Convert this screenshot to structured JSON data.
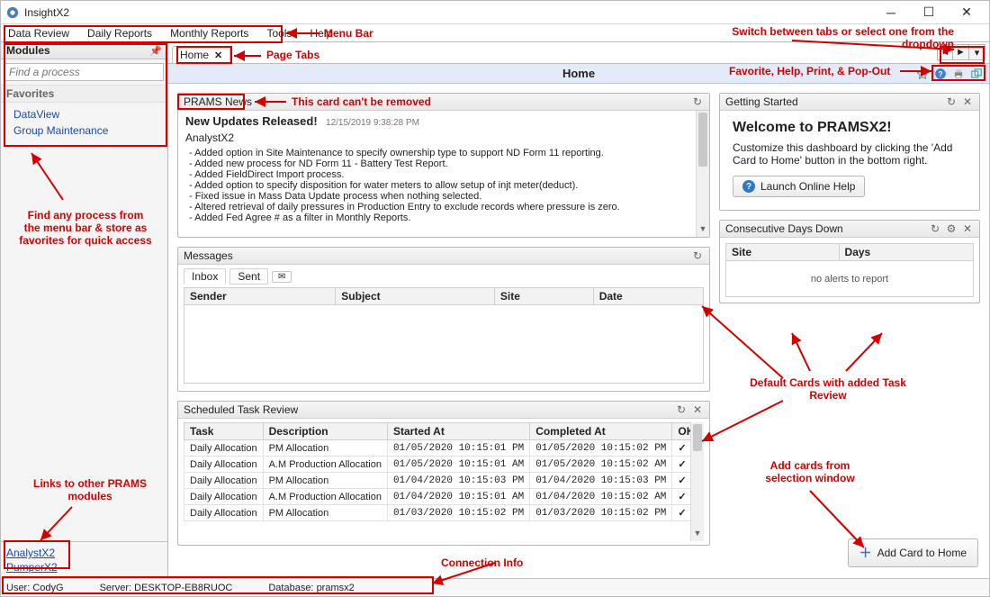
{
  "app": {
    "title": "InsightX2"
  },
  "menus": [
    "Data Review",
    "Daily Reports",
    "Monthly Reports",
    "Tools",
    "Help"
  ],
  "sidebar": {
    "panel_title": "Modules",
    "search_placeholder": "Find a process",
    "fav_header": "Favorites",
    "favorites": [
      "DataView",
      "Group Maintenance"
    ],
    "module_links": [
      "AnalystX2",
      "PumperX2"
    ]
  },
  "tabs": {
    "home_label": "Home"
  },
  "page": {
    "title": "Home"
  },
  "cards": {
    "news": {
      "title": "PRAMS News",
      "headline": "New Updates Released!",
      "date": "12/15/2019 9:38:28 PM",
      "subhead": "AnalystX2",
      "items": [
        "Added option in Site Maintenance to specify ownership type to support ND Form 11 reporting.",
        "Added new process for ND Form 11 - Battery Test Report.",
        "Added FieldDirect Import process.",
        "Added option to specify disposition for water meters to allow setup of injt meter(deduct).",
        "Fixed issue in Mass Data Update process when nothing selected.",
        "Altered retrieval of daily pressures in Production Entry to exclude records where pressure is zero.",
        "Added Fed Agree # as a filter in Monthly Reports."
      ]
    },
    "messages": {
      "title": "Messages",
      "tab_inbox": "Inbox",
      "tab_sent": "Sent",
      "cols": [
        "Sender",
        "Subject",
        "Site",
        "Date"
      ]
    },
    "tasks": {
      "title": "Scheduled Task Review",
      "cols": [
        "Task",
        "Description",
        "Started At",
        "Completed At",
        "OK"
      ],
      "rows": [
        {
          "task": "Daily Allocation",
          "desc": "PM Allocation",
          "start": "01/05/2020 10:15:01 PM",
          "end": "01/05/2020 10:15:02 PM",
          "ok": true
        },
        {
          "task": "Daily Allocation",
          "desc": "A.M Production Allocation",
          "start": "01/05/2020 10:15:01 AM",
          "end": "01/05/2020 10:15:02 AM",
          "ok": true
        },
        {
          "task": "Daily Allocation",
          "desc": "PM Allocation",
          "start": "01/04/2020 10:15:03 PM",
          "end": "01/04/2020 10:15:03 PM",
          "ok": true
        },
        {
          "task": "Daily Allocation",
          "desc": "A.M Production Allocation",
          "start": "01/04/2020 10:15:01 AM",
          "end": "01/04/2020 10:15:02 AM",
          "ok": true
        },
        {
          "task": "Daily Allocation",
          "desc": "PM Allocation",
          "start": "01/03/2020 10:15:02 PM",
          "end": "01/03/2020 10:15:02 PM",
          "ok": true
        }
      ]
    },
    "getting_started": {
      "title": "Getting Started",
      "heading": "Welcome to PRAMSX2!",
      "desc": "Customize this dashboard by clicking the 'Add Card to Home' button in the bottom right.",
      "help_btn": "Launch Online Help"
    },
    "cdd": {
      "title": "Consecutive Days Down",
      "cols": [
        "Site",
        "Days"
      ],
      "empty": "no alerts to report"
    },
    "add_card_label": "Add Card to Home"
  },
  "status": {
    "user_label": "User:",
    "user": "CodyG",
    "server_label": "Server:",
    "server": "DESKTOP-EB8RUOC",
    "db_label": "Database:",
    "db": "pramsx2"
  },
  "annotations": {
    "menu_bar": "Menu Bar",
    "page_tabs": "Page Tabs",
    "switch_tabs": "Switch between tabs or select one from the dropdown",
    "card_no_remove": "This card can't be removed",
    "fav_help_print": "Favorite, Help, Print, & Pop-Out",
    "find_process": "Find any process from the menu bar & store as favorites for quick access",
    "default_cards": "Default Cards with added Task Review",
    "add_cards": "Add cards from selection window",
    "mod_links": "Links to other PRAMS modules",
    "conn_info": "Connection Info"
  }
}
